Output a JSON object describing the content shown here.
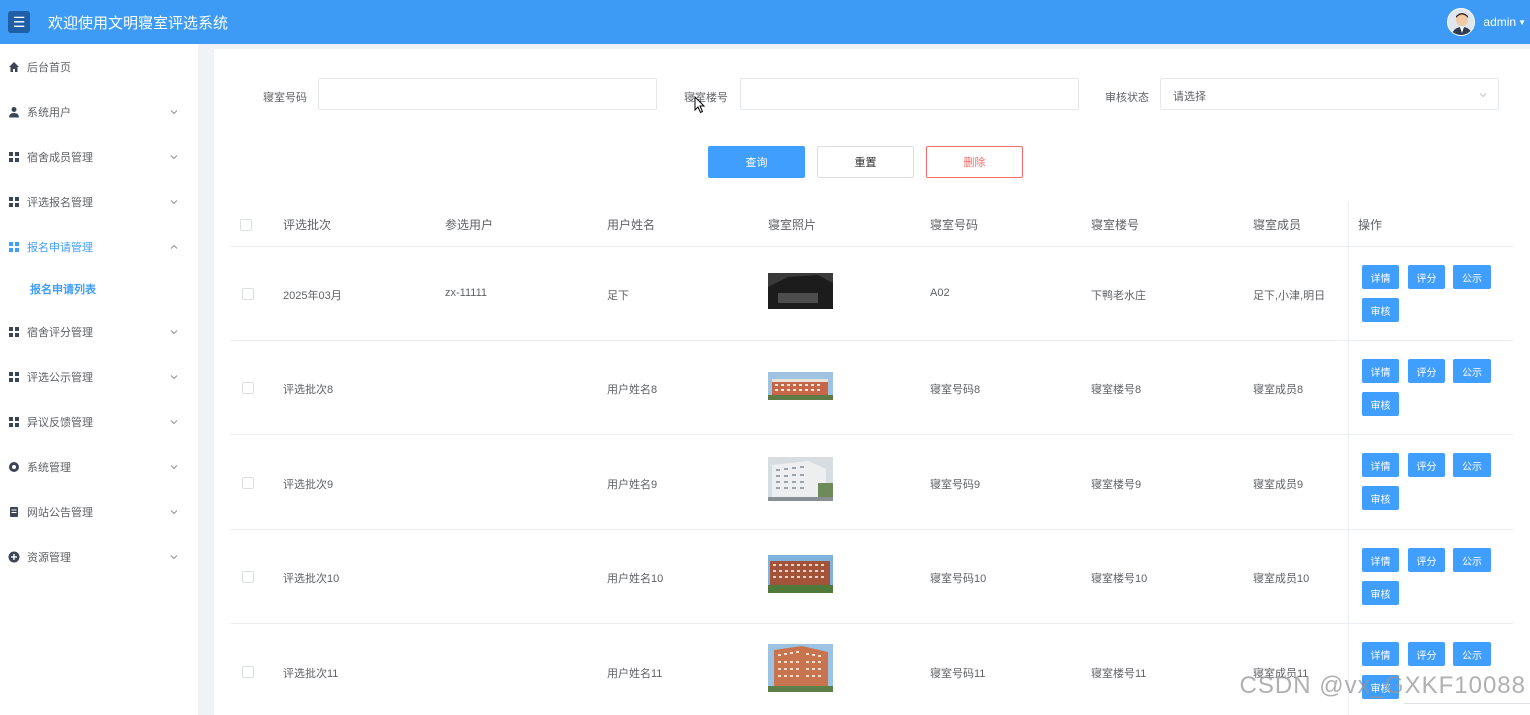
{
  "header": {
    "title": "欢迎使用文明寝室评选系统",
    "username": "admin",
    "brand_color": "#3d9bf5"
  },
  "sidebar": {
    "items": [
      {
        "label": "后台首页",
        "icon": "home-icon"
      },
      {
        "label": "系统用户",
        "icon": "user-icon"
      },
      {
        "label": "宿舍成员管理",
        "icon": "grid-icon"
      },
      {
        "label": "评选报名管理",
        "icon": "grid-icon"
      },
      {
        "label": "报名申请管理",
        "icon": "grid-icon",
        "expanded": true
      },
      {
        "label": "宿舍评分管理",
        "icon": "grid-icon"
      },
      {
        "label": "评选公示管理",
        "icon": "grid-icon"
      },
      {
        "label": "异议反馈管理",
        "icon": "grid-icon"
      },
      {
        "label": "系统管理",
        "icon": "gear-icon"
      },
      {
        "label": "网站公告管理",
        "icon": "document-icon"
      },
      {
        "label": "资源管理",
        "icon": "plus-circle-icon"
      }
    ],
    "sub_active": "报名申请列表"
  },
  "filters": {
    "room_no_label": "寝室号码",
    "room_no_value": "",
    "building_label": "寝室楼号",
    "building_value": "",
    "status_label": "审核状态",
    "status_placeholder": "请选择"
  },
  "actions": {
    "search": "查询",
    "reset": "重置",
    "delete": "删除"
  },
  "table": {
    "headers": [
      "评选批次",
      "参选用户",
      "用户姓名",
      "寝室照片",
      "寝室号码",
      "寝室楼号",
      "寝室成员",
      "操作"
    ],
    "rows": [
      {
        "batch": "2025年03月",
        "participant": "zx-11111",
        "name": "足下",
        "room_no": "A02",
        "building": "下鸭老水庄",
        "members": "足下,小津,明日"
      },
      {
        "batch": "评选批次8",
        "participant": "",
        "name": "用户姓名8",
        "room_no": "寝室号码8",
        "building": "寝室楼号8",
        "members": "寝室成员8"
      },
      {
        "batch": "评选批次9",
        "participant": "",
        "name": "用户姓名9",
        "room_no": "寝室号码9",
        "building": "寝室楼号9",
        "members": "寝室成员9"
      },
      {
        "batch": "评选批次10",
        "participant": "",
        "name": "用户姓名10",
        "room_no": "寝室号码10",
        "building": "寝室楼号10",
        "members": "寝室成员10"
      },
      {
        "batch": "评选批次11",
        "participant": "",
        "name": "用户姓名11",
        "room_no": "寝室号码11",
        "building": "寝室楼号11",
        "members": "寝室成员11"
      }
    ],
    "row_actions": {
      "detail": "详情",
      "score": "评分",
      "publicize": "公示",
      "audit": "审核"
    }
  },
  "watermark": "CSDN @vx_GXKF10088"
}
